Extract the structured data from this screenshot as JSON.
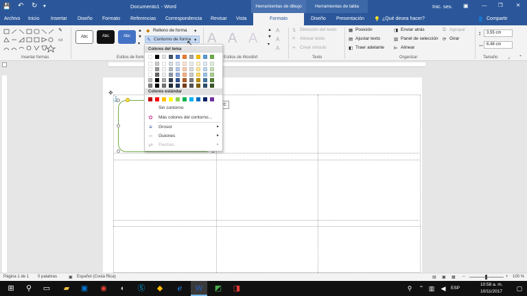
{
  "titlebar": {
    "doc_title": "Documento1 - Word",
    "ctx_drawing": "Herramientas de dibujo",
    "ctx_table": "Herramientas de tabla",
    "signin": "Inic. ses.",
    "minimize": "—",
    "restore": "❐",
    "close": "✕",
    "save_icon": "💾",
    "undo_icon": "↶",
    "redo_icon": "↻",
    "qat_more": "▾"
  },
  "tabs": [
    "Archivo",
    "Inicio",
    "Insertar",
    "Diseño",
    "Formato",
    "Referencias",
    "Correspondencia",
    "Revisar",
    "Vista",
    "Formato",
    "Diseño",
    "Presentación"
  ],
  "tell_me": "¿Qué desea hacer?",
  "share": "Compartir",
  "ribbon": {
    "groups": {
      "insert_shapes": "Insertar formas",
      "shape_styles": "Estilos de forma",
      "wordart": "Estilos de WordArt",
      "text": "Texto",
      "arrange": "Organizar",
      "size": "Tamaño"
    },
    "style_labels": [
      "Abc",
      "Abc",
      "Abc"
    ],
    "fill": "Relleno de forma",
    "outline": "Contorno de forma",
    "wordart_letter": "A",
    "text_direction": "Dirección del texto",
    "align_text": "Alinear texto",
    "create_link": "Crear vínculo",
    "position": "Posición",
    "wrap_text": "Ajustar texto",
    "bring_forward": "Traer adelante",
    "send_backward": "Enviar atrás",
    "selection_pane": "Panel de selección",
    "align": "Alinear",
    "group": "Agrupar",
    "rotate": "Girar",
    "height": "3,55 cm",
    "width": "6,48 cm"
  },
  "dropdown": {
    "theme_header": "Colores del tema",
    "standard_header": "Colores estándar",
    "no_outline": "Sin contorno",
    "more_colors": "Más colores del contorno...",
    "weight": "Grosor",
    "dashes": "Guiones",
    "arrows": "Flechas",
    "theme_colors": [
      "#ffffff",
      "#000000",
      "#e7e6e6",
      "#44546a",
      "#4472c4",
      "#ed7d31",
      "#a5a5a5",
      "#ffc000",
      "#5b9bd5",
      "#70ad47"
    ],
    "standard_colors": [
      "#c00000",
      "#ff0000",
      "#ffc000",
      "#ffff00",
      "#92d050",
      "#00b050",
      "#00b0f0",
      "#0070c0",
      "#002060",
      "#7030a0"
    ]
  },
  "status": {
    "page": "Página 1 de 1",
    "words": "0 palabras",
    "language": "Español (Costa Rica)",
    "zoom": "100 %"
  },
  "taskbar": {
    "time": "10:58 a. m.",
    "date": "10/11/2017",
    "lang": "ESP"
  }
}
